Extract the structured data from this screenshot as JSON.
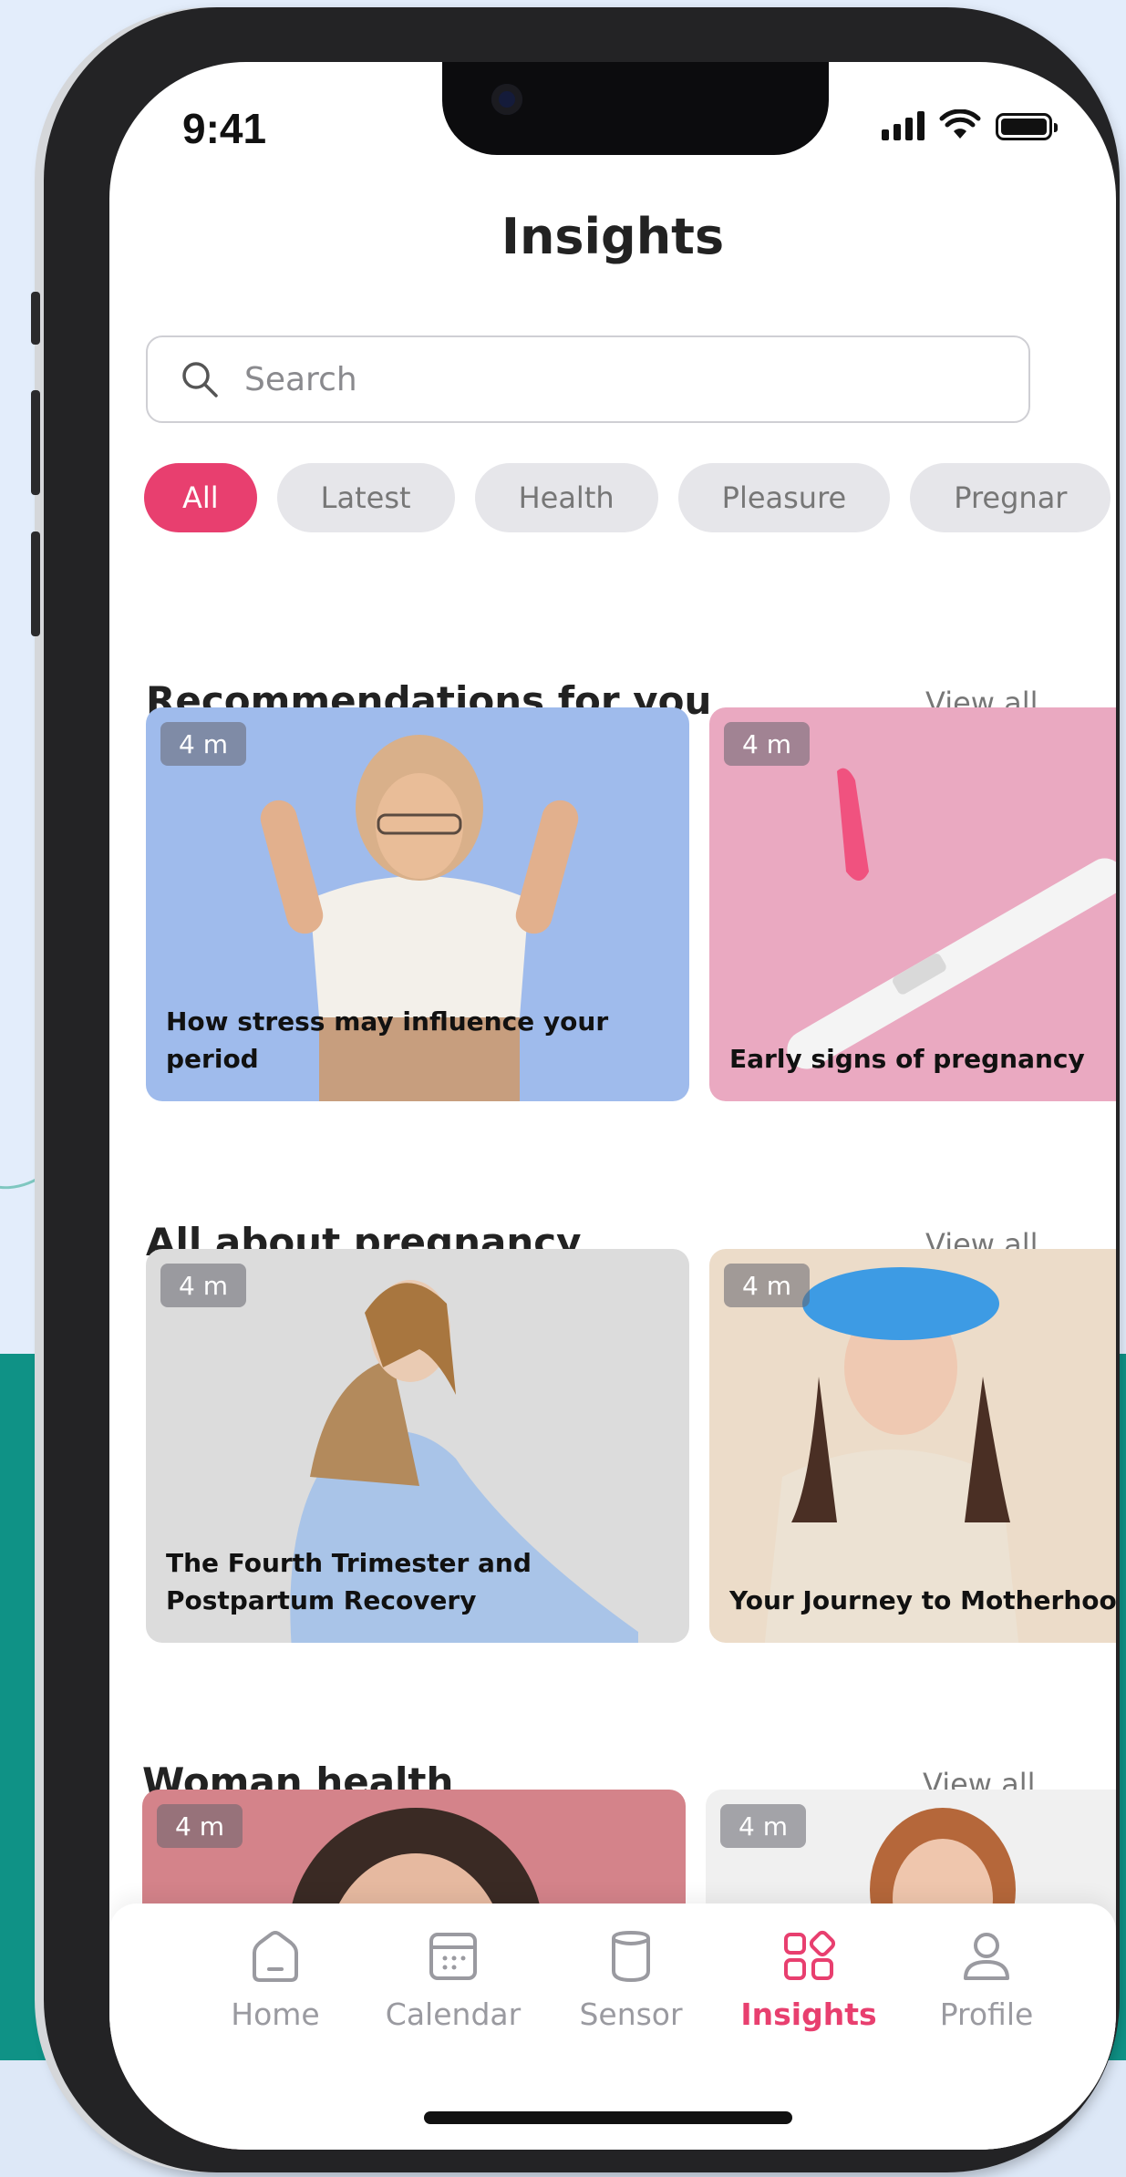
{
  "status_bar": {
    "time": "9:41",
    "signal_icon": "cellular-signal-icon",
    "wifi_icon": "wifi-icon",
    "battery_icon": "battery-icon"
  },
  "header": {
    "title": "Insights"
  },
  "search": {
    "placeholder": "Search",
    "icon": "search-icon"
  },
  "filters": [
    {
      "label": "All",
      "active": true
    },
    {
      "label": "Latest",
      "active": false
    },
    {
      "label": "Health",
      "active": false
    },
    {
      "label": "Pleasure",
      "active": false
    },
    {
      "label": "Pregnar",
      "active": false
    }
  ],
  "sections": [
    {
      "title": "Recommendations for you",
      "view_all": "View all",
      "cards": [
        {
          "duration": "4 m",
          "title": "How stress may influence your period",
          "bg": "#9fbbec"
        },
        {
          "duration": "4 m",
          "title": "Early signs of pregnancy",
          "bg": "#eaa9c1"
        }
      ]
    },
    {
      "title": "All about pregnancy",
      "view_all": "View all",
      "cards": [
        {
          "duration": "4 m",
          "title": "The Fourth Trimester and Postpartum Recovery",
          "bg": "#dcdcdc"
        },
        {
          "duration": "4 m",
          "title": "Your Journey to Motherhood",
          "bg": "#ecdcc9"
        }
      ]
    },
    {
      "title": "Woman health",
      "view_all": "View all",
      "cards": [
        {
          "duration": "4 m",
          "title": "",
          "bg": "#d4838a"
        },
        {
          "duration": "4 m",
          "title": "",
          "bg": "#f0f0f0"
        }
      ]
    }
  ],
  "bottom_nav": [
    {
      "label": "Home",
      "icon": "home-icon",
      "active": false
    },
    {
      "label": "Calendar",
      "icon": "calendar-icon",
      "active": false
    },
    {
      "label": "Sensor",
      "icon": "sensor-icon",
      "active": false
    },
    {
      "label": "Insights",
      "icon": "insights-grid-icon",
      "active": true
    },
    {
      "label": "Profile",
      "icon": "profile-icon",
      "active": false
    }
  ],
  "colors": {
    "accent": "#e83f6f",
    "teal_background": "#0f9286",
    "light_background": "#e3edfb"
  }
}
